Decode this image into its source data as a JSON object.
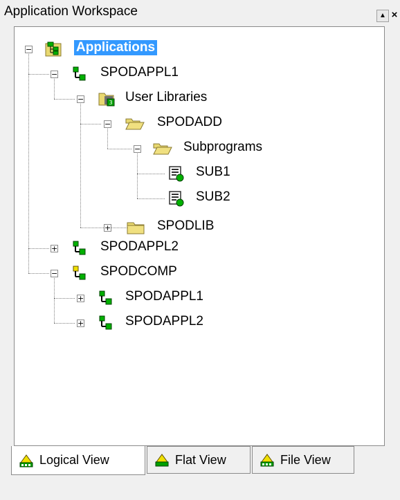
{
  "window": {
    "title": "Application Workspace",
    "restore_glyph": "▲",
    "close_glyph": "×"
  },
  "tree": [
    {
      "label": "Applications",
      "icon": "applications-icon",
      "level": 0,
      "expander": "−",
      "selected": true
    },
    {
      "label": "SPODAPPL1",
      "icon": "application-node-icon",
      "level": 1,
      "expander": "−"
    },
    {
      "label": "User Libraries",
      "icon": "user-libraries-folder-icon",
      "level": 2,
      "expander": "−"
    },
    {
      "label": "SPODADD",
      "icon": "open-folder-icon",
      "level": 3,
      "expander": "−"
    },
    {
      "label": "Subprograms",
      "icon": "open-folder-icon",
      "level": 4,
      "expander": "−"
    },
    {
      "label": "SUB1",
      "icon": "subprogram-icon",
      "level": 5,
      "expander": ""
    },
    {
      "label": "SUB2",
      "icon": "subprogram-icon",
      "level": 5,
      "expander": ""
    },
    {
      "label": "SPODLIB",
      "icon": "closed-folder-icon",
      "level": 3,
      "expander": "+"
    },
    {
      "label": "SPODAPPL2",
      "icon": "application-node-icon",
      "level": 1,
      "expander": "+"
    },
    {
      "label": "SPODCOMP",
      "icon": "compound-application-icon",
      "level": 1,
      "expander": "−"
    },
    {
      "label": "SPODAPPL1",
      "icon": "application-node-icon",
      "level": 2,
      "expander": "+"
    },
    {
      "label": "SPODAPPL2",
      "icon": "application-node-icon",
      "level": 2,
      "expander": "+"
    }
  ],
  "tabs": [
    {
      "label": "Logical View",
      "icon": "logical-view-icon",
      "active": true
    },
    {
      "label": "Flat View",
      "icon": "flat-view-icon",
      "active": false
    },
    {
      "label": "File View",
      "icon": "file-view-icon",
      "active": false
    }
  ],
  "colors": {
    "selection": "#3399ff",
    "node_green": "#00a000",
    "folder_yellow": "#e8d870"
  }
}
